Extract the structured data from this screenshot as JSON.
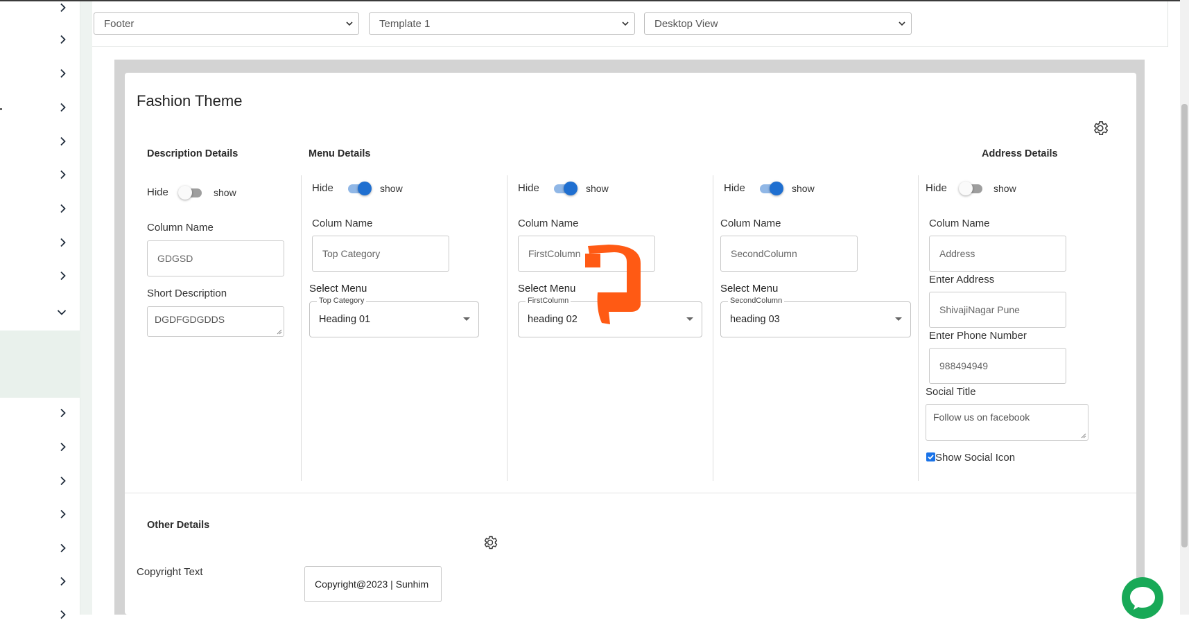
{
  "topbar": {
    "select_section": "Footer",
    "select_template": "Template 1",
    "select_view": "Desktop View"
  },
  "sidebar": {
    "chevrons": [
      "chevron-right-icon",
      "chevron-right-icon",
      "chevron-right-icon",
      "chevron-right-icon",
      "chevron-right-icon",
      "chevron-right-icon",
      "chevron-right-icon",
      "chevron-right-icon",
      "chevron-right-icon",
      "chevron-down-icon",
      "chevron-right-icon",
      "chevron-right-icon",
      "chevron-right-icon",
      "chevron-right-icon",
      "chevron-right-icon",
      "chevron-right-icon",
      "chevron-right-icon"
    ]
  },
  "theme": {
    "title": "Fashion Theme"
  },
  "description": {
    "heading": "Description Details",
    "hide": "Hide",
    "show": "show",
    "toggle_on": false,
    "column_name_label": "Column Name",
    "column_name_value": "GDGSD",
    "short_desc_label": "Short Description",
    "short_desc_value": "DGDFGDGDDS"
  },
  "menu": {
    "heading": "Menu Details",
    "columns": [
      {
        "hide": "Hide",
        "show": "show",
        "toggle_on": true,
        "colum_name_label": "Colum Name",
        "colum_name_value": "Top Category",
        "select_label": "Select Menu",
        "legend": "Top Category",
        "selected": "Heading 01"
      },
      {
        "hide": "Hide",
        "show": "show",
        "toggle_on": true,
        "colum_name_label": "Colum Name",
        "colum_name_value": "FirstColumn",
        "select_label": "Select Menu",
        "legend": "FirstColumn",
        "selected": "heading 02"
      },
      {
        "hide": "Hide",
        "show": "show",
        "toggle_on": true,
        "colum_name_label": "Colum Name",
        "colum_name_value": "SecondColumn",
        "select_label": "Select Menu",
        "legend": "SecondColumn",
        "selected": "heading 03"
      }
    ]
  },
  "address": {
    "heading": "Address Details",
    "hide": "Hide",
    "show": "show",
    "toggle_on": false,
    "colum_name_label": "Colum Name",
    "colum_name_value": "Address",
    "enter_address_label": "Enter Address",
    "enter_address_value": "ShivajiNagar Pune",
    "phone_label": "Enter Phone Number",
    "phone_value": "988494949",
    "social_title_label": "Social Title",
    "social_title_value": "Follow us on facebook",
    "show_social_icon_label": "Show Social Icon",
    "show_social_icon_checked": true
  },
  "other": {
    "heading": "Other Details",
    "copyright_label": "Copyright Text",
    "copyright_value": "Copyright@2023 | Sunhim"
  },
  "colors": {
    "accent_blue": "#1f6fd0",
    "chat_green": "#18a957",
    "annotation_orange": "#ff5a14"
  }
}
